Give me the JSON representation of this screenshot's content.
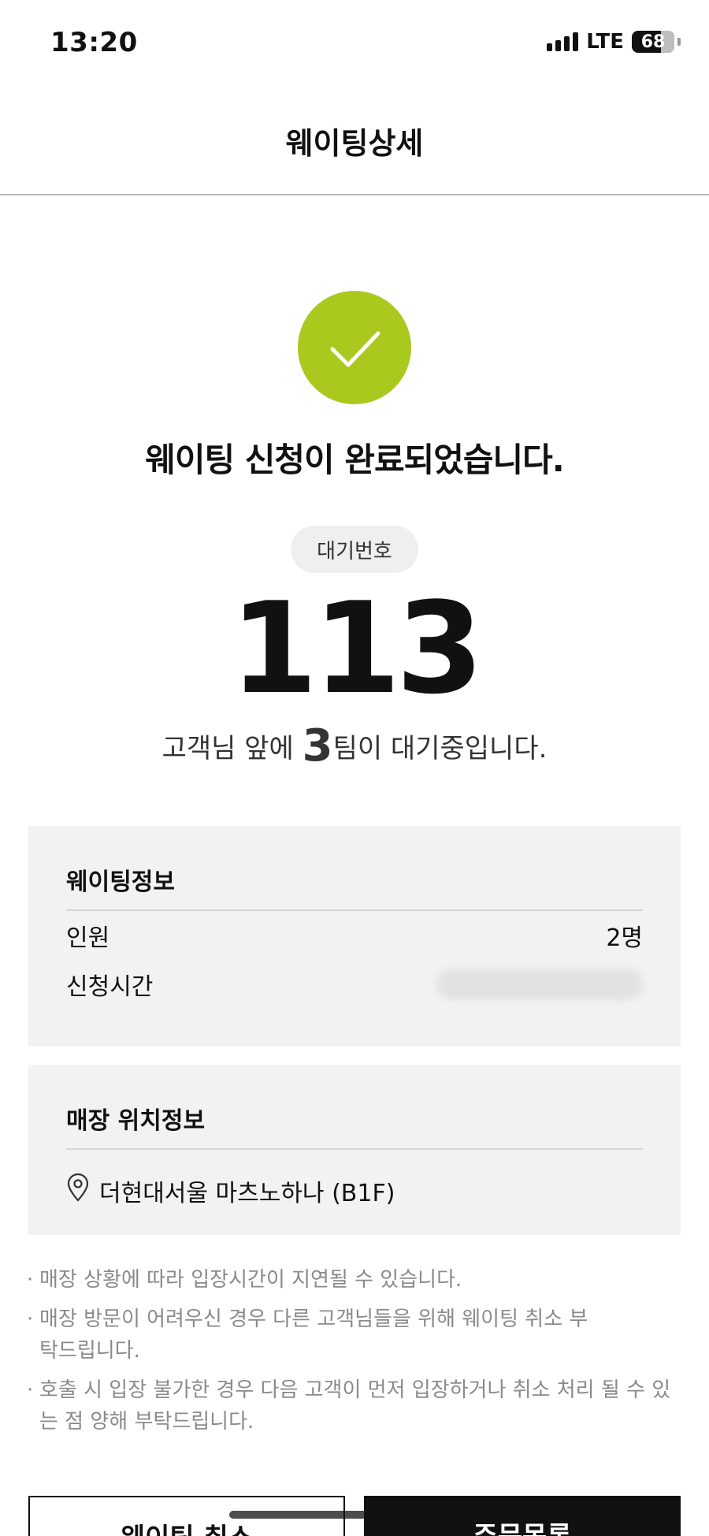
{
  "status_bar": {
    "time": "13:20",
    "network": "LTE",
    "battery": "68"
  },
  "header": {
    "title": "웨이팅상세"
  },
  "result": {
    "message": "웨이팅 신청이 완료되었습니다.",
    "badge_label": "대기번호",
    "wait_number": "113",
    "queue_prefix": "고객님 앞에 ",
    "queue_count": "3",
    "queue_suffix": "팀이 대기중입니다."
  },
  "waiting_info": {
    "title": "웨이팅정보",
    "rows": [
      {
        "label": "인원",
        "value": "2명"
      },
      {
        "label": "신청시간",
        "value": ""
      }
    ]
  },
  "location_info": {
    "title": "매장 위치정보",
    "place": "더현대서울 마츠노하나 (B1F)"
  },
  "notes": [
    "매장 상황에 따라 입장시간이 지연될 수 있습니다.",
    "매장 방문이 어려우신 경우 다른 고객님들을 위해 웨이팅 취소 부탁드립니다.",
    "호출 시 입장 불가한 경우 다음 고객이 먼저 입장하거나 취소 처리 될 수 있는 점 양해 부탁드립니다."
  ],
  "buttons": {
    "cancel": "웨이팅 취소",
    "order": "주문목록"
  },
  "colors": {
    "accent": "#a9c91f",
    "panel_bg": "#f2f2f2",
    "text": "#111111"
  }
}
